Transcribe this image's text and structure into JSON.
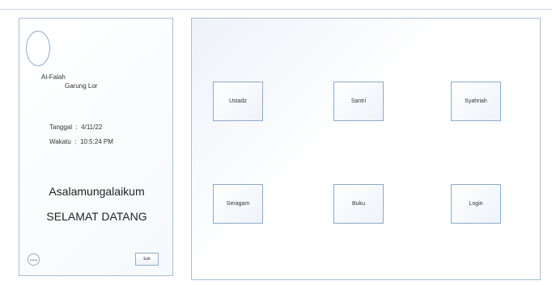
{
  "sidebar": {
    "org_name": "Al-Falah",
    "org_location": "Garung Lor",
    "date_label": "Tanggal",
    "date_value": "4/11/22",
    "time_label": "Wakatu",
    "time_value": "10:5:24 PM",
    "greeting": "Asalamungalaikum",
    "welcome": "SELAMAT DATANG",
    "setting_label": "Setting",
    "exit_label": "Exit"
  },
  "menu": {
    "items": [
      {
        "label": "Ustadz"
      },
      {
        "label": "Santri"
      },
      {
        "label": "Syahriah"
      },
      {
        "label": "Seragam"
      },
      {
        "label": "Buku"
      },
      {
        "label": "Login"
      }
    ]
  }
}
